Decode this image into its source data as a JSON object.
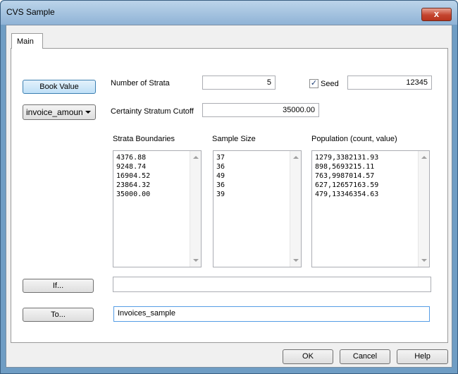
{
  "window": {
    "title": "CVS Sample",
    "close_glyph": "x"
  },
  "tabs": [
    {
      "label": "Main"
    }
  ],
  "buttons": {
    "book_value": "Book Value",
    "if": "If...",
    "to": "To...",
    "ok": "OK",
    "cancel": "Cancel",
    "help": "Help"
  },
  "field_dropdown": {
    "value": "invoice_amoun"
  },
  "number_of_strata": {
    "label": "Number of Strata",
    "value": "5"
  },
  "seed": {
    "label": "Seed",
    "checked": true,
    "value": "12345"
  },
  "certainty_cutoff": {
    "label": "Certainty Stratum Cutoff",
    "value": "35000.00"
  },
  "strata_boundaries": {
    "label": "Strata Boundaries",
    "items": [
      "4376.88",
      "9248.74",
      "16904.52",
      "23864.32",
      "35000.00"
    ]
  },
  "sample_size": {
    "label": "Sample Size",
    "items": [
      "37",
      "36",
      "49",
      "36",
      "39"
    ]
  },
  "population": {
    "label": "Population (count, value)",
    "items": [
      "1279,3382131.93",
      "898,5693215.11",
      "763,9987014.57",
      "627,12657163.59",
      "479,13346354.63"
    ]
  },
  "if_field": {
    "value": ""
  },
  "to_field": {
    "value": "Invoices_sample"
  },
  "colors": {
    "titlebar": "#8fb3d6",
    "close": "#c4452f",
    "dialog_bg": "#f0f0f0",
    "focus": "#569de5"
  }
}
